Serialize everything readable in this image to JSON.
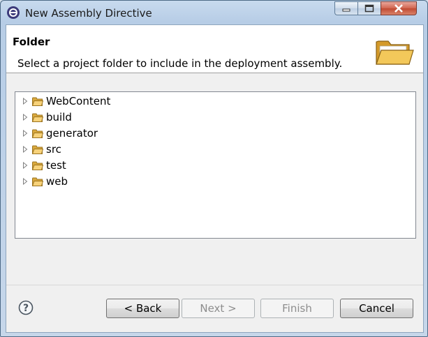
{
  "window": {
    "title": "New Assembly Directive"
  },
  "header": {
    "title": "Folder",
    "description": "Select a project folder to include in the deployment assembly.",
    "icon": "folder-open-icon"
  },
  "tree": {
    "items": [
      {
        "label": "WebContent"
      },
      {
        "label": "build"
      },
      {
        "label": "generator"
      },
      {
        "label": "src"
      },
      {
        "label": "test"
      },
      {
        "label": "web"
      }
    ]
  },
  "buttons": {
    "back": "< Back",
    "next": "Next >",
    "finish": "Finish",
    "cancel": "Cancel"
  },
  "colors": {
    "title_bar": "#b7cde6",
    "close_button": "#c04a33",
    "folder": "#e8b84a"
  }
}
